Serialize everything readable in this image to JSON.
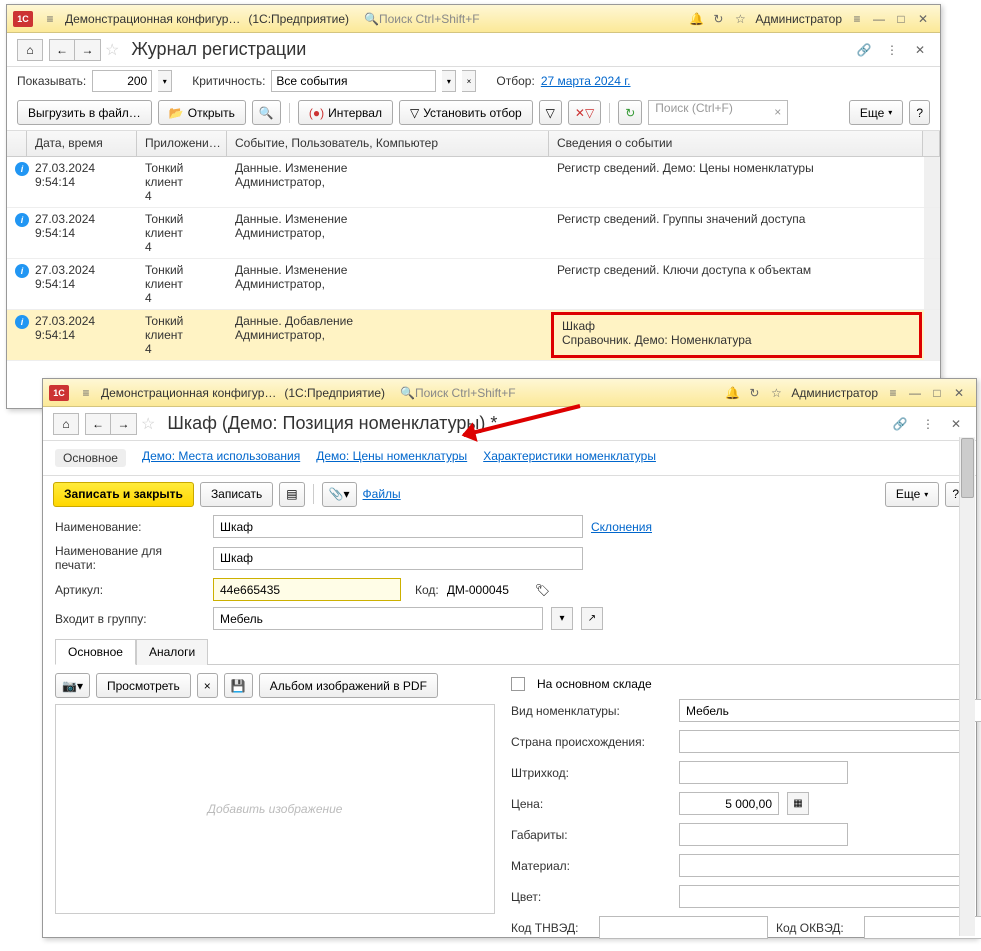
{
  "app": {
    "name": "Демонстрационная конфигур…",
    "platform": "(1С:Предприятие)",
    "search_placeholder": "Поиск Ctrl+Shift+F",
    "user": "Администратор"
  },
  "w1": {
    "title": "Журнал регистрации",
    "show_label": "Показывать:",
    "show_value": "200",
    "crit_label": "Критичность:",
    "crit_value": "Все события",
    "filter_label": "Отбор:",
    "filter_date": "27 марта 2024 г.",
    "btn_export": "Выгрузить в файл…",
    "btn_open": "Открыть",
    "btn_interval": "Интервал",
    "btn_setfilter": "Установить отбор",
    "btn_more": "Еще",
    "search_ph": "Поиск (Ctrl+F)",
    "cols": {
      "c1": "Дата, время",
      "c2": "Приложени…",
      "c3": "Событие, Пользователь, Компьютер",
      "c4": "Сведения о событии"
    },
    "rows": [
      {
        "d1": "27.03.2024",
        "d2": "9:54:14",
        "app1": "Тонкий клиент",
        "app2": "4",
        "e1": "Данные. Изменение",
        "e2": "Администратор,",
        "s1": "Регистр сведений. Демо: Цены номенклатуры",
        "s2": ""
      },
      {
        "d1": "27.03.2024",
        "d2": "9:54:14",
        "app1": "Тонкий клиент",
        "app2": "4",
        "e1": "Данные. Изменение",
        "e2": "Администратор,",
        "s1": "Регистр сведений. Группы значений доступа",
        "s2": ""
      },
      {
        "d1": "27.03.2024",
        "d2": "9:54:14",
        "app1": "Тонкий клиент",
        "app2": "4",
        "e1": "Данные. Изменение",
        "e2": "Администратор,",
        "s1": "Регистр сведений. Ключи доступа к объектам",
        "s2": ""
      },
      {
        "d1": "27.03.2024",
        "d2": "9:54:14",
        "app1": "Тонкий клиент",
        "app2": "4",
        "e1": "Данные. Добавление",
        "e2": "Администратор,",
        "s1": "Шкаф",
        "s2": "Справочник. Демо: Номенклатура"
      }
    ]
  },
  "w2": {
    "title": "Шкаф (Демо: Позиция номенклатуры) *",
    "tabs": [
      "Основное",
      "Демо: Места использования",
      "Демо: Цены номенклатуры",
      "Характеристики номенклатуры"
    ],
    "btn_save_close": "Записать и закрыть",
    "btn_save": "Записать",
    "link_files": "Файлы",
    "btn_more": "Еще",
    "f": {
      "name_l": "Наименование:",
      "name_v": "Шкаф",
      "decl": "Склонения",
      "pname_l": "Наименование для печати:",
      "pname_v": "Шкаф",
      "art_l": "Артикул:",
      "art_v": "44е665435",
      "code_l": "Код:",
      "code_v": "ДМ-000045",
      "grp_l": "Входит в группу:",
      "grp_v": "Мебель"
    },
    "itabs": [
      "Основное",
      "Аналоги"
    ],
    "img": {
      "btn_view": "Просмотреть",
      "btn_album": "Альбом изображений в PDF",
      "placeholder": "Добавить изображение"
    },
    "r": {
      "stock": "На основном складе",
      "kind_l": "Вид номенклатуры:",
      "kind_v": "Мебель",
      "country_l": "Страна происхождения:",
      "barcode_l": "Штрихкод:",
      "price_l": "Цена:",
      "price_v": "5 000,00",
      "dims_l": "Габариты:",
      "mat_l": "Материал:",
      "color_l": "Цвет:",
      "tnved_l": "Код ТНВЭД:",
      "okved_l": "Код ОКВЭД:"
    }
  }
}
